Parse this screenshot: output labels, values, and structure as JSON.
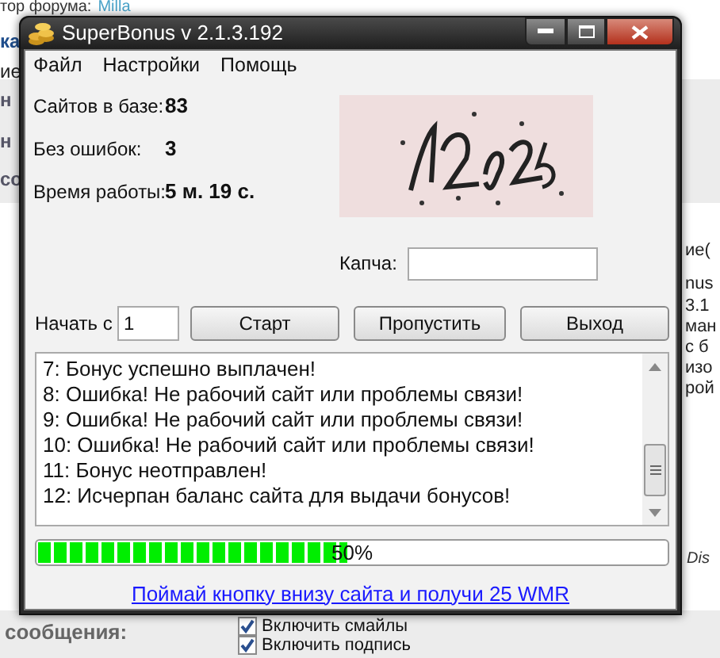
{
  "background_page": {
    "author_label": "тор форума:",
    "author": "Milla",
    "left_fragments": [
      "ка",
      "ие",
      "н",
      "н",
      "со"
    ],
    "right_fragments": [
      "ие(",
      "nus",
      "3.1",
      "ман",
      "с б",
      "изо",
      "рой"
    ],
    "right_note": "Dis",
    "message_label": "сообщения:",
    "options": [
      {
        "label": "Включить смайлы",
        "checked": true
      },
      {
        "label": "Включить подпись",
        "checked": true
      }
    ]
  },
  "window": {
    "title": "SuperBonus v 2.1.3.192"
  },
  "menu": [
    "Файл",
    "Настройки",
    "Помощь"
  ],
  "stats": [
    {
      "label": "Сайтов в базе:",
      "value": "83"
    },
    {
      "label": "Без ошибок:",
      "value": "3"
    },
    {
      "label": "Время работы:",
      "value": "5 м. 19 с."
    }
  ],
  "captcha_label": "Капча:",
  "start_from": {
    "label": "Начать с",
    "value": "1"
  },
  "buttons": [
    "Старт",
    "Пропустить",
    "Выход"
  ],
  "log": [
    "7: Бонус успешно выплачен!",
    "8: Ошибка! Не рабочий сайт или проблемы связи!",
    "9: Ошибка! Не рабочий сайт или проблемы связи!",
    "10: Ошибка! Не рабочий сайт или проблемы связи!",
    "11: Бонус неотправлен!",
    "12: Исчерпан баланс сайта для выдачи бонусов!"
  ],
  "progress": {
    "level": 0.49,
    "reading": "50%"
  },
  "link": "Поймай кнопку внизу сайта и получи 25 WMR"
}
